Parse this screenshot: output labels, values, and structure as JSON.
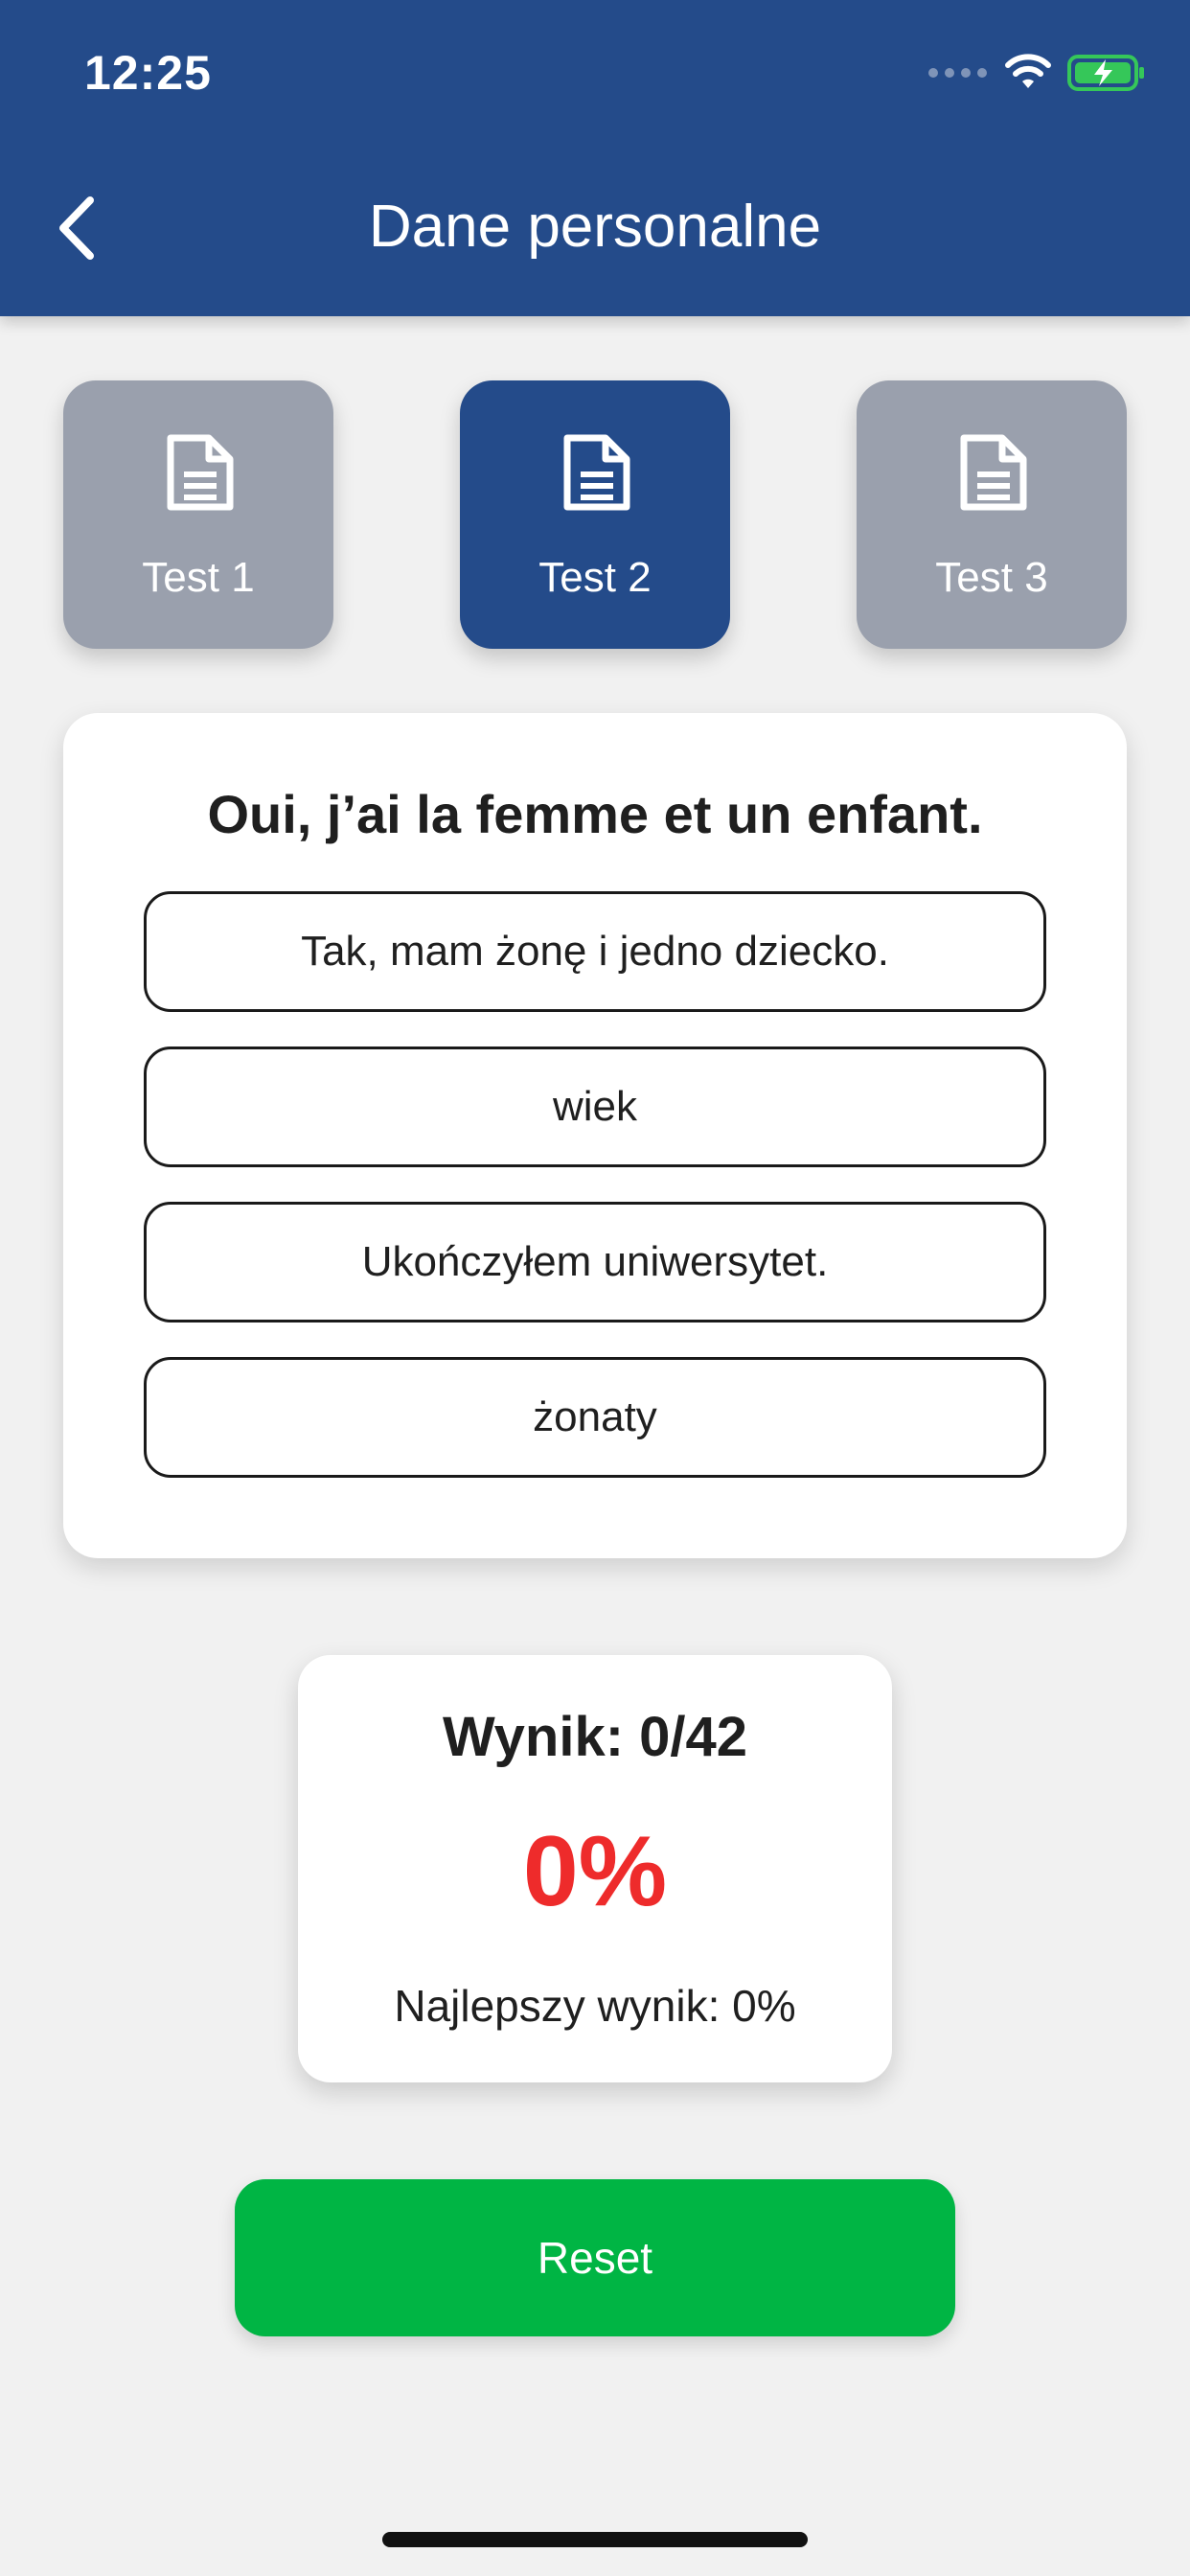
{
  "status_bar": {
    "time": "12:25"
  },
  "header": {
    "title": "Dane personalne",
    "back_icon": "chevron-left-icon"
  },
  "tabs": [
    {
      "label": "Test 1",
      "icon": "document-icon",
      "active": false
    },
    {
      "label": "Test 2",
      "icon": "document-icon",
      "active": true
    },
    {
      "label": "Test 3",
      "icon": "document-icon",
      "active": false
    }
  ],
  "quiz": {
    "question": "Oui, j’ai la femme et un enfant.",
    "answers": [
      "Tak, mam żonę i jedno dziecko.",
      "wiek",
      "Ukończyłem uniwersytet.",
      "żonaty"
    ]
  },
  "score": {
    "title": "Wynik: 0/42",
    "percent": "0%",
    "best": "Najlepszy wynik: 0%"
  },
  "reset_label": "Reset",
  "colors": {
    "header": "#244b8a",
    "tab_active": "#244b8a",
    "tab_inactive": "#9aa0ad",
    "reset": "#00b544",
    "percent": "#ee2b2b",
    "battery_fill": "#35c759"
  }
}
